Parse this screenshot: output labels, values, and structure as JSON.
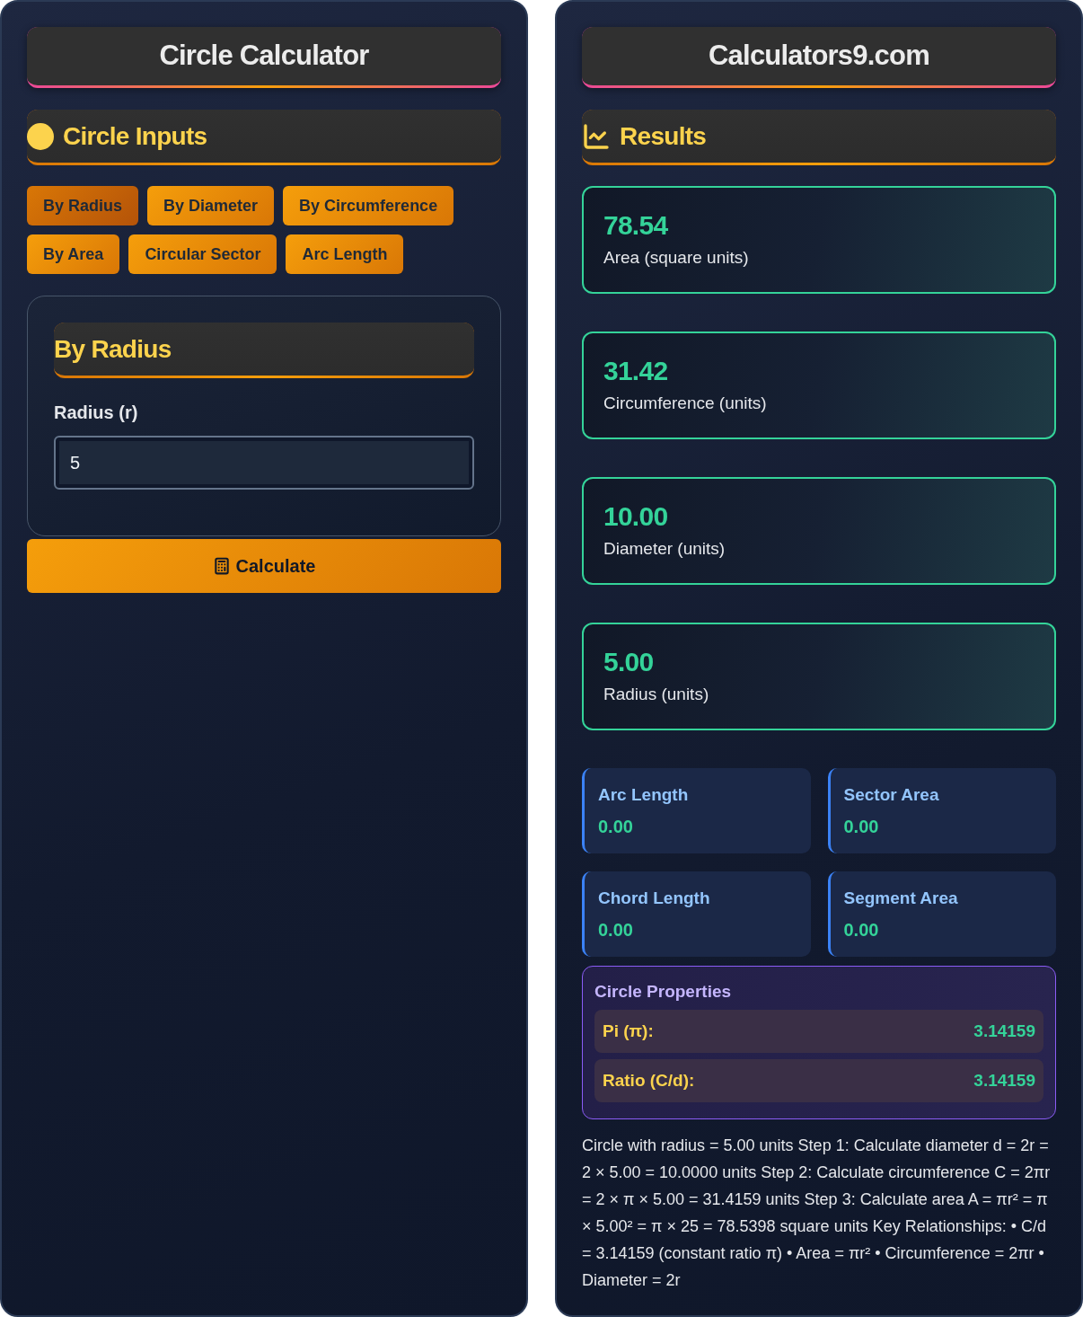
{
  "left_panel": {
    "title": "Circle Calculator",
    "section": {
      "title": "Circle Inputs"
    },
    "tabs": [
      {
        "label": "By Radius",
        "selected": true
      },
      {
        "label": "By Diameter",
        "selected": false
      },
      {
        "label": "By Circumference",
        "selected": false
      },
      {
        "label": "By Area",
        "selected": false
      },
      {
        "label": "Circular Sector",
        "selected": false
      },
      {
        "label": "Arc Length",
        "selected": false
      }
    ],
    "form": {
      "title": "By Radius",
      "fields": [
        {
          "label": "Radius (r)",
          "value": "5"
        }
      ]
    },
    "calculate_button": {
      "label": "Calculate"
    }
  },
  "right_panel": {
    "title": "Calculators9.com",
    "section": {
      "title": "Results"
    },
    "results": [
      {
        "value": "78.54",
        "label": "Area (square units)"
      },
      {
        "value": "31.42",
        "label": "Circumference (units)"
      },
      {
        "value": "10.00",
        "label": "Diameter (units)"
      },
      {
        "value": "5.00",
        "label": "Radius (units)"
      }
    ],
    "metrics": [
      {
        "label": "Arc Length",
        "value": "0.00"
      },
      {
        "label": "Sector Area",
        "value": "0.00"
      },
      {
        "label": "Chord Length",
        "value": "0.00"
      },
      {
        "label": "Segment Area",
        "value": "0.00"
      }
    ],
    "properties": {
      "title": "Circle Properties",
      "rows": [
        {
          "label": "Pi (π):",
          "value": "3.14159"
        },
        {
          "label": "Ratio (C/d):",
          "value": "3.14159"
        }
      ]
    },
    "explanation": "Circle with radius = 5.00 units Step 1: Calculate diameter d = 2r = 2 × 5.00 = 10.0000 units Step 2: Calculate circumference C = 2πr = 2 × π × 5.00 = 31.4159 units Step 3: Calculate area A = πr² = π × 5.00² = π × 25 = 78.5398 square units Key Relationships: • C/d = 3.14159 (constant ratio π) • Area = πr² • Circumference = 2πr • Diameter = 2r"
  }
}
